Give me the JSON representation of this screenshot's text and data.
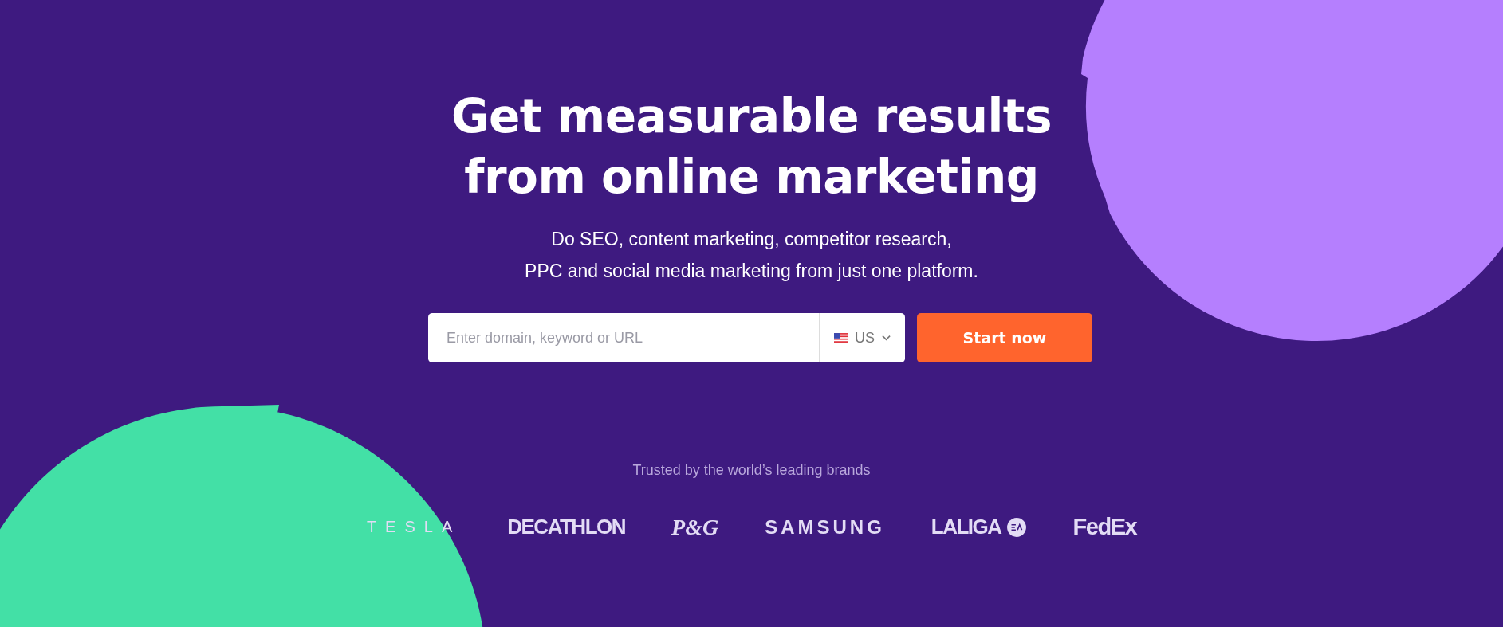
{
  "hero": {
    "title_lines": [
      "Get measurable results",
      "from online marketing"
    ],
    "subtitle_lines": [
      "Do SEO, content marketing, competitor research,",
      "PPC and social media marketing from just one platform."
    ]
  },
  "search": {
    "placeholder": "Enter domain, keyword or URL",
    "country": "US",
    "button": "Start now"
  },
  "brands": {
    "caption": "Trusted by the world’s leading brands",
    "logos": [
      {
        "kind": "spaced",
        "text": "TESLA"
      },
      {
        "kind": "condensed",
        "text": "DECATHLON"
      },
      {
        "kind": "script",
        "text": "P&G"
      },
      {
        "kind": "wide",
        "text": "SAMSUNG"
      },
      {
        "kind": "badge",
        "text": "LALIGA"
      },
      {
        "kind": "fedex",
        "text": "FedEx"
      }
    ]
  }
}
